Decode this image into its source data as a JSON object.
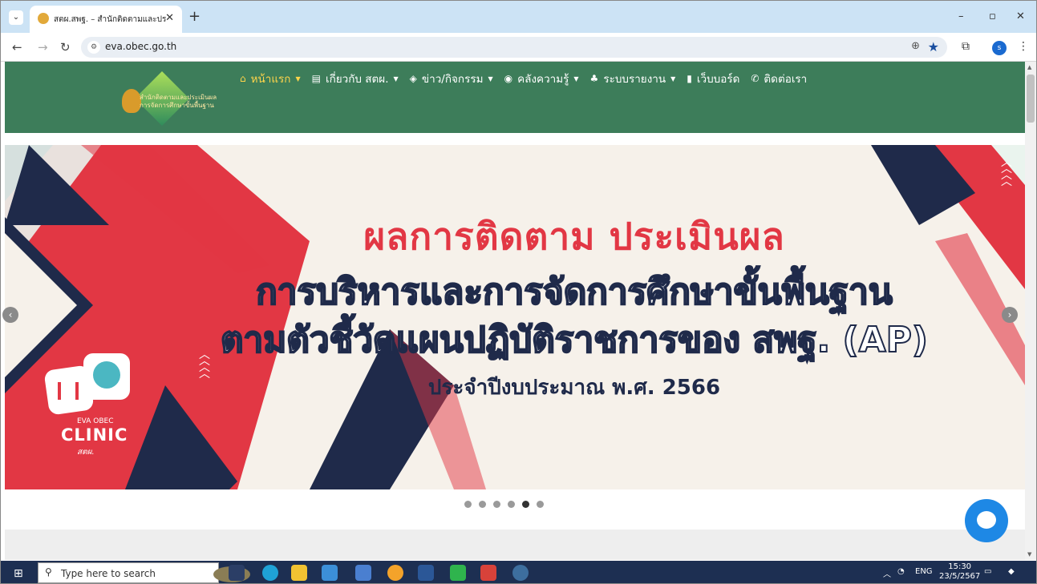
{
  "browser": {
    "tab_title": "สตผ.สพฐ. – สำนักติดตามและประเมิน",
    "tab_menu_icon": "chevron-down-icon",
    "new_tab": "+",
    "url": "eva.obec.go.th",
    "profile_initial": "s",
    "window_controls": [
      "–",
      "▫",
      "✕"
    ]
  },
  "site": {
    "logo_line1": "สำนักติดตามและประเมินผล",
    "logo_line2": "การจัดการศึกษาขั้นพื้นฐาน",
    "menu": [
      {
        "label": "หน้าแรก",
        "icon": "home-icon",
        "has_dropdown": true,
        "active": true
      },
      {
        "label": "เกี่ยวกับ สตผ.",
        "icon": "book-icon",
        "has_dropdown": true,
        "active": false
      },
      {
        "label": "ข่าว/กิจกรรม",
        "icon": "tag-icon",
        "has_dropdown": true,
        "active": false
      },
      {
        "label": "คลังความรู้",
        "icon": "globe-icon",
        "has_dropdown": true,
        "active": false
      },
      {
        "label": "ระบบรายงาน",
        "icon": "sitemap-icon",
        "has_dropdown": true,
        "active": false
      },
      {
        "label": "เว็บบอร์ด",
        "icon": "comment-icon",
        "has_dropdown": false,
        "active": false
      },
      {
        "label": "ติดต่อเรา",
        "icon": "phone-icon",
        "has_dropdown": false,
        "active": false
      }
    ]
  },
  "banner": {
    "title": "ผลการติดตาม ประเมินผล",
    "line2": "การบริหารและการจัดการศึกษาขั้นพื้นฐาน",
    "line3": "ตามตัวชี้วัดแผนปฏิบัติราชการของ สพฐ. (AP)",
    "line4": "ประจำปีงบประมาณ พ.ศ. 2566",
    "clinic_small": "EVA OBEC",
    "clinic_big": "CLINIC",
    "clinic_sub": "สตผ.",
    "slide_count": 6,
    "active_slide": 5
  },
  "colors": {
    "header_green": "#3d7d5a",
    "banner_red": "#e23744",
    "banner_navy": "#1f2a4a",
    "menu_active": "#ffd54a"
  },
  "taskbar": {
    "search_placeholder": "Type here to search",
    "lang": "ENG",
    "time": "15:30",
    "date": "23/5/2567"
  }
}
